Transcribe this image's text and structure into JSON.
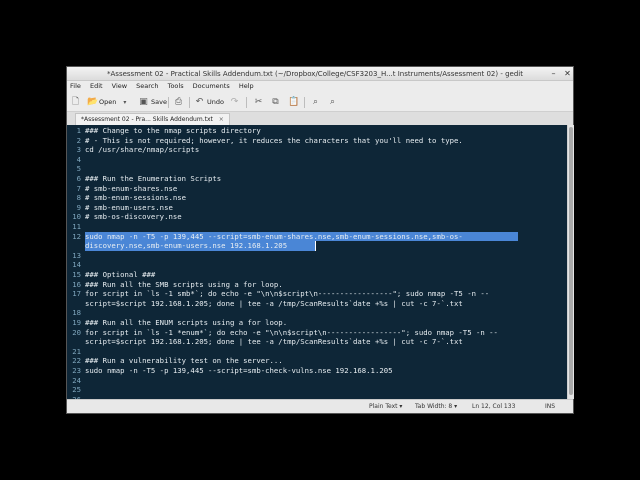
{
  "window": {
    "title": "*Assessment 02 - Practical Skills Addendum.txt (~/Dropbox/College/CSF3203_H...t Instruments/Assessment 02) - gedit"
  },
  "menu": [
    "File",
    "Edit",
    "View",
    "Search",
    "Tools",
    "Documents",
    "Help"
  ],
  "toolbar": {
    "open_label": "Open",
    "save_label": "Save",
    "undo_label": "Undo"
  },
  "tab": {
    "label": "*Assessment 02 - Pra... Skills Addendum.txt",
    "close": "×"
  },
  "editor": {
    "lines": [
      {
        "n": "1",
        "t": "### Change to the nmap scripts directory"
      },
      {
        "n": "2",
        "t": "# - This is not required; however, it reduces the characters that you'll need to type."
      },
      {
        "n": "3",
        "t": "cd /usr/share/nmap/scripts"
      },
      {
        "n": "4",
        "t": ""
      },
      {
        "n": "5",
        "t": ""
      },
      {
        "n": "6",
        "t": "### Run the Enumeration Scripts"
      },
      {
        "n": "7",
        "t": "# smb-enum-shares.nse"
      },
      {
        "n": "8",
        "t": "# smb-enum-sessions.nse"
      },
      {
        "n": "9",
        "t": "# smb-enum-users.nse"
      },
      {
        "n": "10",
        "t": "# smb-os-discovery.nse"
      },
      {
        "n": "11",
        "t": ""
      },
      {
        "n": "12",
        "t": "sudo nmap -n -T5 -p 139,445 --script=smb-enum-shares.nse,smb-enum-sessions.nse,smb-os-"
      },
      {
        "n": "",
        "t": "discovery.nse,smb-enum-users.nse 192.168.1.205"
      },
      {
        "n": "13",
        "t": ""
      },
      {
        "n": "14",
        "t": ""
      },
      {
        "n": "15",
        "t": "### Optional ###"
      },
      {
        "n": "16",
        "t": "### Run all the SMB scripts using a for loop."
      },
      {
        "n": "17",
        "t": "for script in `ls -1 smb*`; do echo -e \"\\n\\n$script\\n-----------------\"; sudo nmap -T5 -n --"
      },
      {
        "n": "",
        "t": "script=$script 192.168.1.205; done | tee -a /tmp/ScanResults`date +%s | cut -c 7-`.txt"
      },
      {
        "n": "18",
        "t": ""
      },
      {
        "n": "19",
        "t": "### Run all the ENUM scripts using a for loop."
      },
      {
        "n": "20",
        "t": "for script in `ls -1 *enum*`; do echo -e \"\\n\\n$script\\n-----------------\"; sudo nmap -T5 -n --"
      },
      {
        "n": "",
        "t": "script=$script 192.168.1.205; done | tee -a /tmp/ScanResults`date +%s | cut -c 7-`.txt"
      },
      {
        "n": "21",
        "t": ""
      },
      {
        "n": "22",
        "t": "### Run a vulnerability test on the server..."
      },
      {
        "n": "23",
        "t": "sudo nmap -n -T5 -p 139,445 --script=smb-check-vulns.nse 192.168.1.205"
      },
      {
        "n": "24",
        "t": ""
      },
      {
        "n": "25",
        "t": ""
      },
      {
        "n": "26",
        "t": ""
      }
    ]
  },
  "status": {
    "syntax": "Plain Text",
    "tab_width": "Tab Width: 8",
    "position": "Ln 12, Col 133",
    "mode": "INS"
  }
}
